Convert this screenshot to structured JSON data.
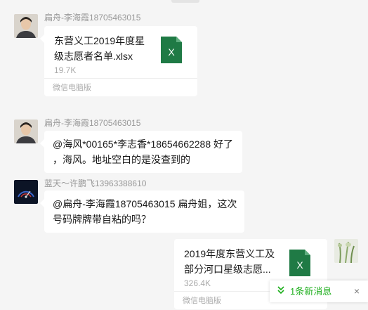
{
  "messages": [
    {
      "sender": "扁舟-李海霞18705463015",
      "type": "file",
      "file_name": "东营义工2019年度星级志愿者名单.xlsx",
      "file_name_lines": [
        "东营义工2019年度星",
        "级志愿者名单.xlsx"
      ],
      "file_size": "19.7K",
      "file_icon": "excel-file-icon",
      "file_icon_letter": "X",
      "source": "微信电脑版"
    },
    {
      "sender": "扁舟-李海霞18705463015",
      "type": "text",
      "text_lines": [
        "@海风*00165*李志香*18654662288 好了",
        "，海风。地址空白的是没查到的"
      ]
    },
    {
      "sender": "蓝天～许鹏飞13963388610",
      "type": "text",
      "text_lines": [
        "@扁舟-李海霞18705463015 扁舟姐，这次",
        "号码牌牌带自粘的吗？"
      ]
    },
    {
      "sender": "",
      "type": "file",
      "file_name_lines": [
        "2019年度东营义工及",
        "部分河口星级志愿..."
      ],
      "file_size": "326.4K",
      "file_icon": "excel-file-icon",
      "file_icon_letter": "X",
      "source": "微信电脑版"
    }
  ],
  "new_message_bar": {
    "label": "1条新消息",
    "close": "×"
  },
  "colors": {
    "excel_green": "#1f7a45",
    "new_message_green": "#1aad19",
    "background": "#f5f5f5"
  }
}
